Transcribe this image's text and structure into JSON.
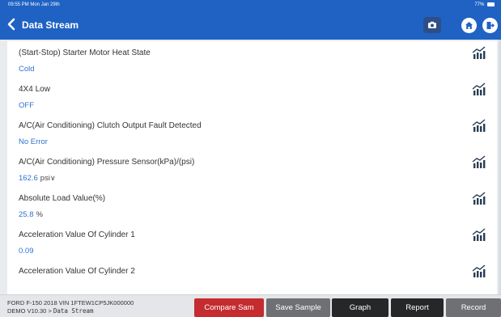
{
  "status": {
    "time": "09:55 PM  Mon Jan 29th",
    "battery": "77%"
  },
  "header": {
    "title": "Data Stream",
    "back_icon": "chevron-left-icon",
    "camera_icon": "camera-icon",
    "home_icon": "home-icon",
    "exit_icon": "exit-icon"
  },
  "rows": [
    {
      "label": "(Start-Stop) Starter Motor Heat State",
      "value": "Cold",
      "unit": "",
      "chevron": ""
    },
    {
      "label": "4X4 Low",
      "value": "OFF",
      "unit": "",
      "chevron": ""
    },
    {
      "label": "A/C(Air Conditioning) Clutch Output Fault Detected",
      "value": "No Error",
      "unit": "",
      "chevron": ""
    },
    {
      "label": "A/C(Air Conditioning) Pressure Sensor(kPa)/(psi)",
      "value": "162.6",
      "unit": "psi",
      "chevron": "∨"
    },
    {
      "label": "Absolute Load Value(%)",
      "value": "25.8",
      "unit": "%",
      "chevron": ""
    },
    {
      "label": "Acceleration Value Of Cylinder 1",
      "value": "0.09",
      "unit": "",
      "chevron": ""
    },
    {
      "label": "Acceleration Value Of Cylinder 2",
      "value": "",
      "unit": "",
      "chevron": ""
    }
  ],
  "footer": {
    "vehicle": "FORD  F-150  2018  VIN  1FTEW1CP5JK000000",
    "demo": "DEMO V10.30 >",
    "path": "Data Stream",
    "buttons": {
      "compare": "Compare Sam",
      "save": "Save Sample",
      "graph": "Graph",
      "report": "Report",
      "record": "Record"
    }
  },
  "colors": {
    "header": "#1f62c4",
    "value_text": "#2d73d0",
    "compare_button": "#c42c2f"
  }
}
